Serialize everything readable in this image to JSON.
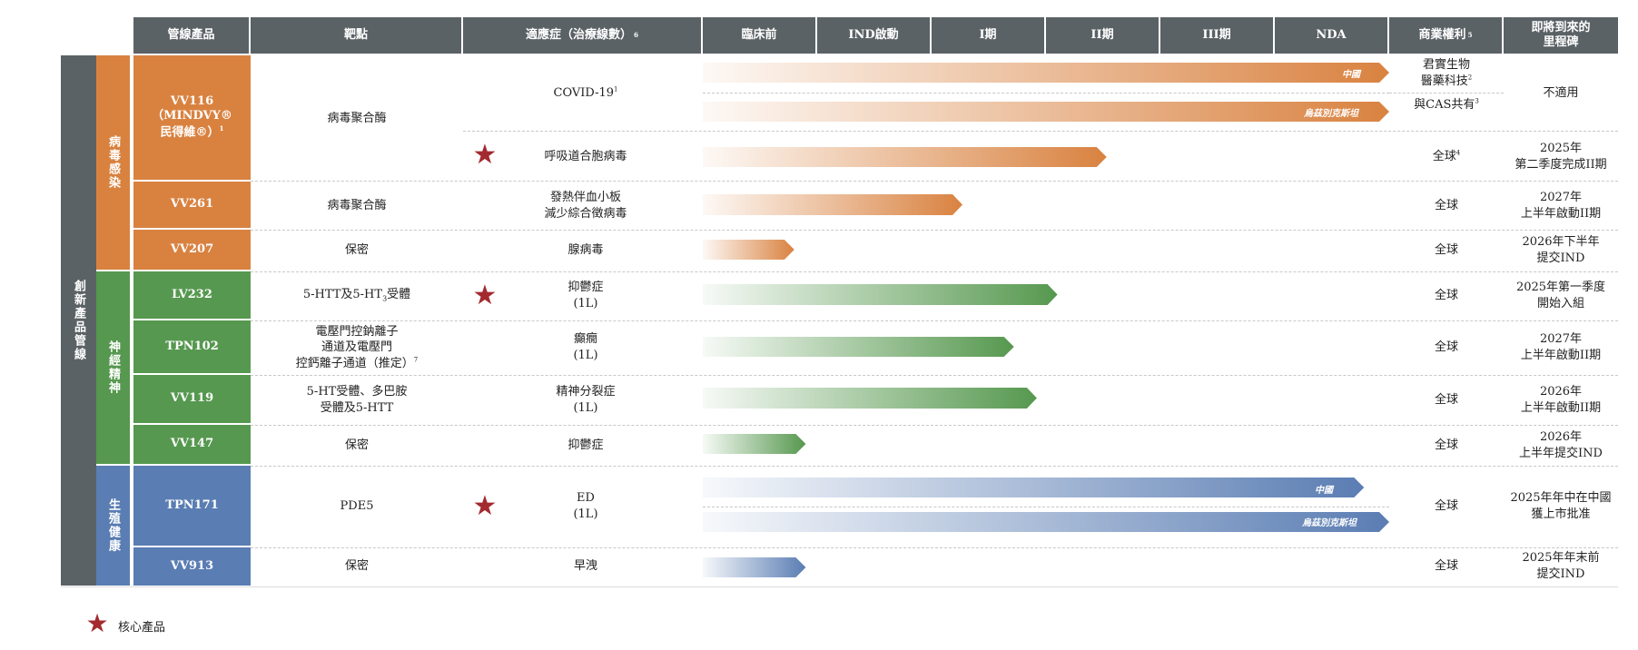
{
  "colors": {
    "header": "#5b6266",
    "viral": "#d98240",
    "cns": "#56984f",
    "mens_health": "#5a7db3",
    "star": "#a32a2f"
  },
  "headers": {
    "product": "管線產品",
    "target": "靶點",
    "indication": "適應症（治療線數）",
    "indication_sup": "6",
    "preclinical": "臨床前",
    "ind": "IND啟動",
    "phase1": "I期",
    "phase2": "II期",
    "phase3": "III期",
    "nda": "NDA",
    "rights": "商業權利",
    "rights_sup": "5",
    "milestone": "即將到來的\n里程碑"
  },
  "left_label": "創新產品管線",
  "categories": {
    "viral": "病毒感染",
    "cns": "神經精神",
    "mens_health": "生殖健康"
  },
  "rows": [
    {
      "product": "VV116\n（MINDVY®\n民得維®）",
      "product_sup": "1",
      "target": "病毒聚合酶",
      "ind1": "COVID-19",
      "ind1_sup": "1",
      "ind2": "呼吸道合胞病毒",
      "bar1_label": "中國",
      "bar2_label": "烏茲別克斯坦",
      "rights1": "君實生物\n醫藥科技",
      "rights1_sup": "2",
      "rights2": "與CAS共有",
      "rights2_sup": "3",
      "rights3": "全球",
      "rights3_sup": "4",
      "milestone1": "不適用",
      "milestone2": "2025年\n第二季度完成II期"
    },
    {
      "product": "VV261",
      "target": "病毒聚合酶",
      "indication": "發熱伴血小板\n減少綜合徵病毒",
      "rights": "全球",
      "milestone": "2027年\n上半年啟動II期"
    },
    {
      "product": "VV207",
      "target": "保密",
      "indication": "腺病毒",
      "rights": "全球",
      "milestone": "2026年下半年\n提交IND"
    },
    {
      "product": "LV232",
      "target": "5-HTT及5-HT",
      "target_sub": "3",
      "target_tail": "受體",
      "indication": "抑鬱症\n(1L)",
      "rights": "全球",
      "milestone": "2025年第一季度\n開始入組"
    },
    {
      "product": "TPN102",
      "target": "電壓門控鈉離子\n通道及電壓門\n控鈣離子通道（推定）",
      "target_sup": "7",
      "indication": "癲癇\n(1L)",
      "rights": "全球",
      "milestone": "2027年\n上半年啟動II期"
    },
    {
      "product": "VV119",
      "target": "5-HT受體、多巴胺\n受體及5-HTT",
      "indication": "精神分裂症\n(1L)",
      "rights": "全球",
      "milestone": "2026年\n上半年啟動II期"
    },
    {
      "product": "VV147",
      "target": "保密",
      "indication": "抑鬱症",
      "rights": "全球",
      "milestone": "2026年\n上半年提交IND"
    },
    {
      "product": "TPN171",
      "target": "PDE5",
      "indication": "ED\n(1L)",
      "bar1_label": "中國",
      "bar2_label": "烏茲別克斯坦",
      "rights": "全球",
      "milestone": "2025年年中在中國\n獲上市批准"
    },
    {
      "product": "VV913",
      "target": "保密",
      "indication": "早洩",
      "rights": "全球",
      "milestone": "2025年年末前\n提交IND"
    }
  ],
  "progress_bars": [
    {
      "id": "vv116-covid-cn",
      "color": "viral",
      "end_stage": "NDA"
    },
    {
      "id": "vv116-covid-uz",
      "color": "viral",
      "end_stage": "NDA"
    },
    {
      "id": "vv116-rsv",
      "color": "viral",
      "end_stage": "II期",
      "fraction": 0.53
    },
    {
      "id": "vv261",
      "color": "viral",
      "end_stage": "I期",
      "fraction": 0.27
    },
    {
      "id": "vv207",
      "color": "viral",
      "end_stage": "臨床前",
      "fraction": 0.8
    },
    {
      "id": "lv232",
      "color": "cns",
      "end_stage": "II期",
      "fraction": 0.1
    },
    {
      "id": "tpn102",
      "color": "cns",
      "end_stage": "I期",
      "fraction": 0.72
    },
    {
      "id": "vv119",
      "color": "cns",
      "end_stage": "I期",
      "fraction": 0.92
    },
    {
      "id": "vv147",
      "color": "cns",
      "end_stage": "臨床前",
      "fraction": 0.9
    },
    {
      "id": "tpn171-cn",
      "color": "mens_health",
      "end_stage": "NDA",
      "fraction": 0.78
    },
    {
      "id": "tpn171-uz",
      "color": "mens_health",
      "end_stage": "NDA"
    },
    {
      "id": "vv913",
      "color": "mens_health",
      "end_stage": "臨床前",
      "fraction": 0.9
    }
  ],
  "legend": {
    "label": "核心產品"
  }
}
